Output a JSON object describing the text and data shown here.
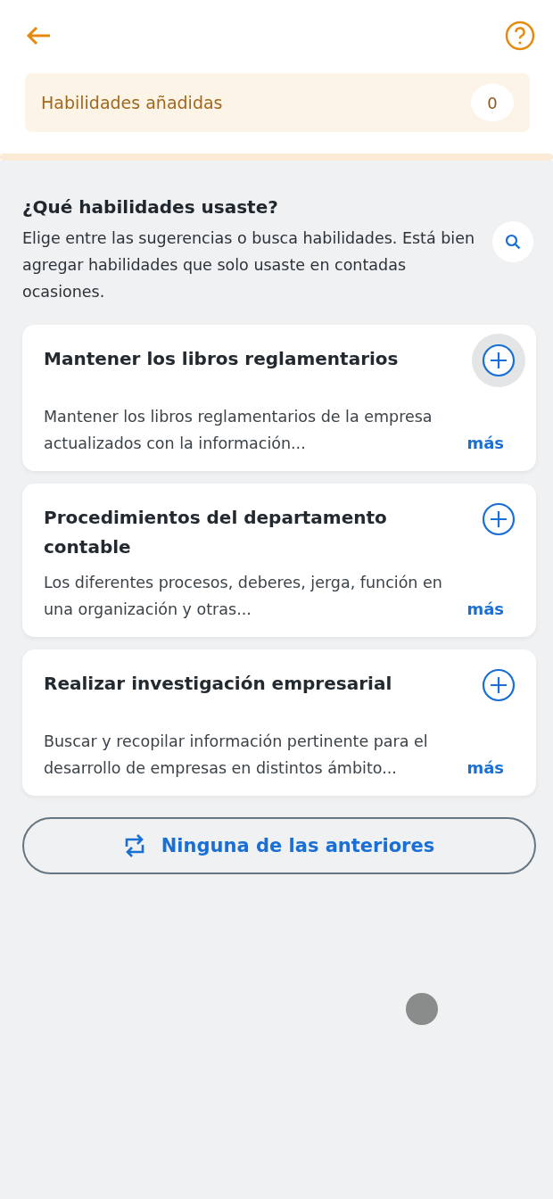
{
  "header": {
    "added_label": "Habilidades añadidas",
    "added_count": "0"
  },
  "question": {
    "title": "¿Qué habilidades usaste?",
    "text": "Elige entre las sugerencias o busca habilidades. Está bien agregar habilidades que solo usaste en contadas ocasiones."
  },
  "skills": [
    {
      "title": "Mantener los libros reglamentarios",
      "description": "Mantener los libros reglamentarios de la empresa actualizados con la información...",
      "more": "más",
      "pressed": true
    },
    {
      "title": "Procedimientos del departamento contable",
      "description": "Los diferentes procesos, deberes, jerga, función en una organización y otras...",
      "more": "más",
      "pressed": false
    },
    {
      "title": "Realizar investigación empresarial",
      "description": "Buscar y recopilar información pertinente para el desarrollo de empresas en distintos ámbito...",
      "more": "más",
      "pressed": false
    }
  ],
  "none_button": "Ninguna de las anteriores"
}
